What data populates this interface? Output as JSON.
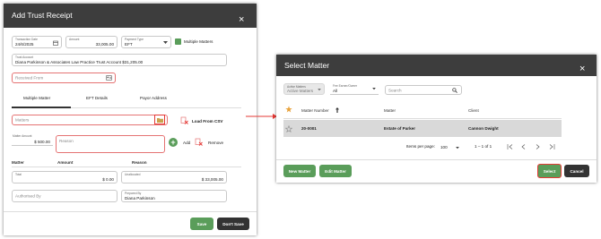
{
  "left_dialog": {
    "title": "Add Trust Receipt",
    "close": "×",
    "transaction_date_label": "Transaction Date",
    "transaction_date": "24/6/2025",
    "amount_label": "Amount",
    "amount": "33,005.00",
    "payment_type_label": "Payment Type",
    "payment_type": "EFT",
    "multiple_matters_label": "Multiple Matters",
    "trust_account_label": "Trust Account",
    "trust_account": "Diana Parkinson & Associates Law Practice Trust Account $31,205.00",
    "received_from_placeholder": "Received From",
    "tabs": [
      "Multiple Matter",
      "EFT Details",
      "Payor Address"
    ],
    "matters_placeholder": "Matters",
    "load_from_csv": "Load From CSV",
    "matter_amount_label": "Matter Amount",
    "matter_amount": "$ 500.00",
    "reason_placeholder": "Reason",
    "add_label": "Add",
    "remove_label": "Remove",
    "table_headers": [
      "Matter",
      "Amount",
      "Reason"
    ],
    "total_label": "Total",
    "total": "$ 0.00",
    "unallocated_label": "Unallocated",
    "unallocated": "$ 33,005.00",
    "authorised_by_placeholder": "Authorised By",
    "prepared_by_label": "Prepared By",
    "prepared_by": "Diana Parkinson",
    "save": "Save",
    "dont_save": "Don't Save"
  },
  "right_dialog": {
    "title": "Select Matter",
    "close": "×",
    "active_matters_label": "Active Matters",
    "active_matters": "Active Matters",
    "fee_earner_label": "Fee Earner/Owner",
    "fee_earner": "All",
    "search_placeholder": "Search",
    "columns": [
      "Matter Number",
      "Matter",
      "Client"
    ],
    "rows": [
      {
        "number": "20-0001",
        "matter": "Estate of Parker",
        "client": "Cannon Dwight"
      }
    ],
    "items_per_page_label": "Items per page:",
    "items_per_page": "100",
    "range": "1 – 1 of 1",
    "new_matter": "New Matter",
    "edit_matter": "Edit Matter",
    "select": "Select",
    "cancel": "Cancel"
  },
  "colors": {
    "accent_green": "#5a9d5a",
    "highlight_red": "#e53935",
    "title_bar": "#3d3d3d"
  }
}
